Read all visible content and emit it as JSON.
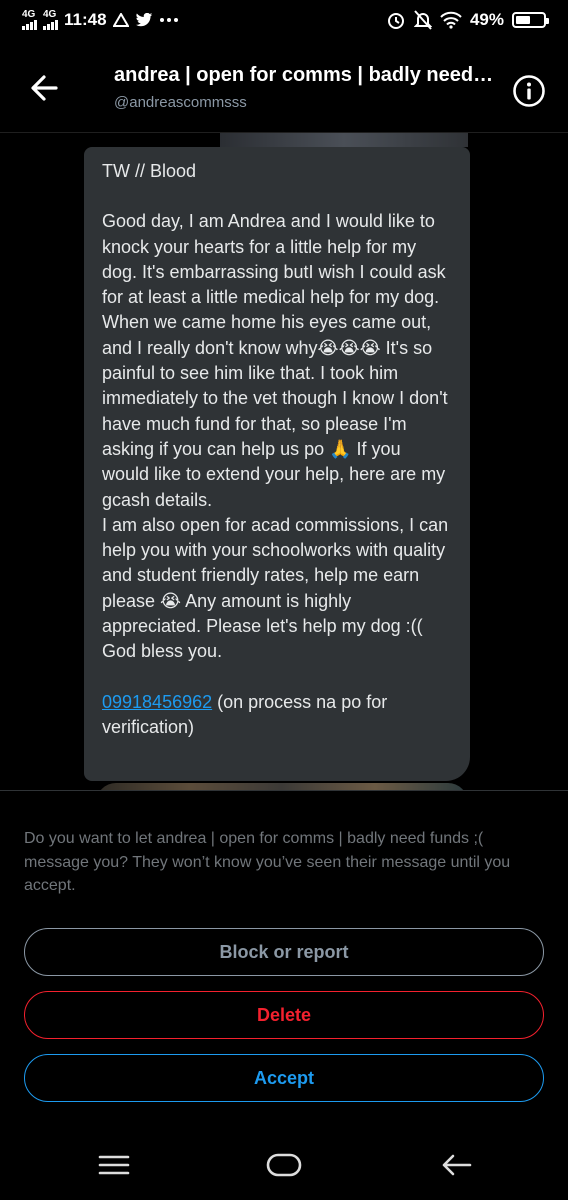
{
  "status_bar": {
    "signal1": "4G",
    "signal2": "4G",
    "time": "11:48",
    "notif_icons": [
      "warning-icon",
      "twitter-icon",
      "more-dots-icon"
    ],
    "right_icons": [
      "alarm-icon",
      "mute-icon",
      "wifi-icon"
    ],
    "battery": "49%",
    "battery_level": 0.49
  },
  "header": {
    "title": "andrea | open for comms | badly need funds ;(",
    "handle": "@andreascommsss"
  },
  "message": {
    "line1": "TW // Blood",
    "body": "Good day, I am Andrea and I would like to knock your hearts for a little help for my dog. It's embarrassing butI wish I could ask for at least a little medical help for my dog. When we came home his eyes came out, and I really don't know why😭😭😭 It's so painful to see him like that. I took him immediately to the vet though I know I don't have much fund for that, so please I'm asking if you can help us po 🙏 If you would like to extend your help, here are my gcash details.\nI am also open for acad commissions, I can help you with your schoolworks with quality and student friendly rates, help me earn please 😭 Any amount is highly appreciated. Please let's help my dog :((\nGod bless you.",
    "phone": "09918456962",
    "phone_note": " (on process na po for verification)"
  },
  "request": {
    "text": "Do you want to let andrea | open for comms | badly need funds ;( message you? They won’t know you’ve seen their message until you accept.",
    "block_label": "Block or report",
    "delete_label": "Delete",
    "accept_label": "Accept"
  },
  "nav": [
    "menu-icon",
    "home-icon",
    "back-icon"
  ],
  "colors": {
    "accent": "#1d9bf0",
    "danger": "#f4212e",
    "bubble": "#2f3336"
  }
}
